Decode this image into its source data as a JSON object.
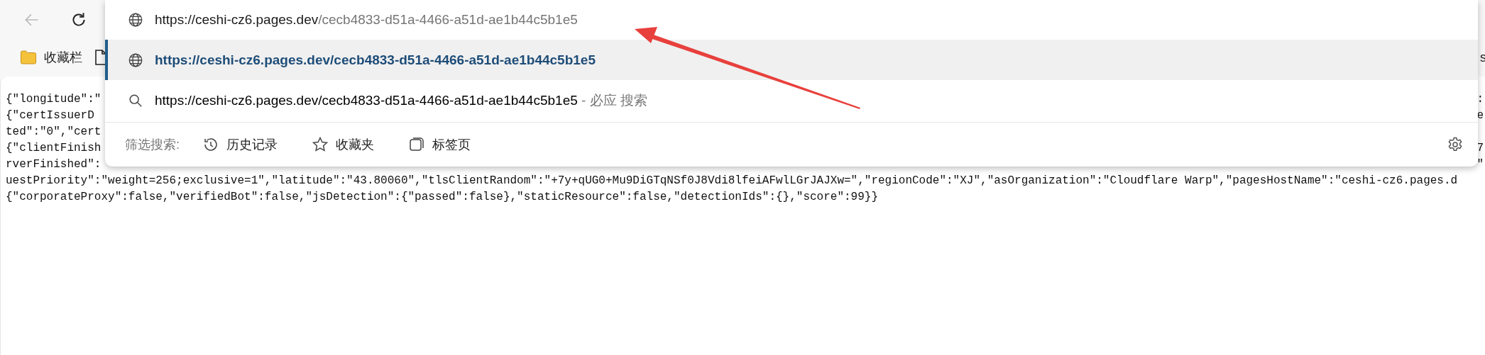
{
  "toolbar": {
    "back": {
      "disabled": true
    }
  },
  "bookmarks_bar": {
    "items": [
      {
        "kind": "folder",
        "label": "收藏栏"
      },
      {
        "kind": "page"
      }
    ],
    "trailing_text": "s"
  },
  "address_dropdown": {
    "address": {
      "host": "https://ceshi-cz6.pages.dev",
      "path": "/cecb4833-d51a-4466-a51d-ae1b44c5b1e5"
    },
    "suggestions": [
      {
        "kind": "url",
        "text": "https://ceshi-cz6.pages.dev/cecb4833-d51a-4466-a51d-ae1b44c5b1e5",
        "selected": true
      },
      {
        "kind": "search",
        "text": "https://ceshi-cz6.pages.dev/cecb4833-d51a-4466-a51d-ae1b44c5b1e5",
        "suffix": "- 必应 搜索",
        "selected": false
      }
    ],
    "filter": {
      "label": "筛选搜索:",
      "options": [
        {
          "kind": "history",
          "label": "历史记录"
        },
        {
          "kind": "favorites",
          "label": "收藏夹"
        },
        {
          "kind": "tabs",
          "label": "标签页"
        }
      ]
    }
  },
  "page_text": {
    "lines": [
      {
        "start": "{\"longitude\":\"",
        "end": ":"
      },
      {
        "start": "{\"certIssuerD",
        "end": "e"
      },
      {
        "start": "ted\":\"0\",\"cert"
      },
      {
        "start": "{\"clientFinish",
        "end": "7"
      },
      {
        "start": "rverFinished\":",
        "end": "\""
      },
      {
        "start": "uestPriority\":\"weight=256;exclusive=1\",\"latitude\":\"43.80060\",\"tlsClientRandom\":\"+7y+qUG0+Mu9DiGTqNSf0J8Vdi8lfeiAFwlLGrJAJXw=\",\"regionCode\":\"XJ\",\"asOrganization\":\"Cloudflare Warp\",\"pagesHostName\":\"ceshi-cz6.pages.d"
      },
      {
        "start": "{\"corporateProxy\":false,\"verifiedBot\":false,\"jsDetection\":{\"passed\":false},\"staticResource\":false,\"detectionIds\":{},\"score\":99}}"
      }
    ]
  }
}
